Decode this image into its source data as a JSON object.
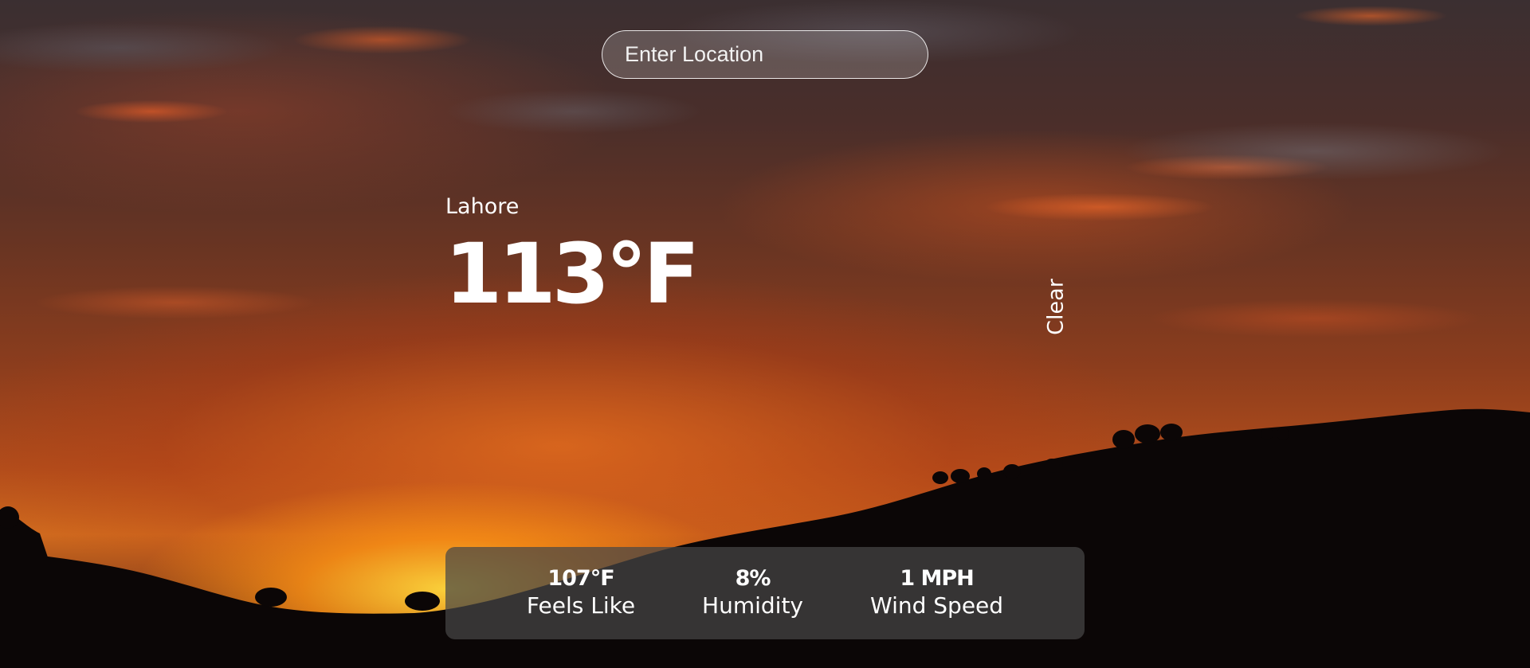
{
  "search": {
    "placeholder": "Enter Location",
    "value": ""
  },
  "weather": {
    "location": "Lahore",
    "temperature": "113°F",
    "condition": "Clear"
  },
  "stats": [
    {
      "value": "107°F",
      "label": "Feels Like"
    },
    {
      "value": "8%",
      "label": "Humidity"
    },
    {
      "value": "1 MPH",
      "label": "Wind Speed"
    }
  ],
  "background": {
    "scene": "sunset-sky-hills-icon",
    "colors": {
      "sky_top": "#3b2f31",
      "sky_mid": "#8c3d1d",
      "horizon_glow": "#ffd23c",
      "hills": "#0b0606"
    }
  }
}
